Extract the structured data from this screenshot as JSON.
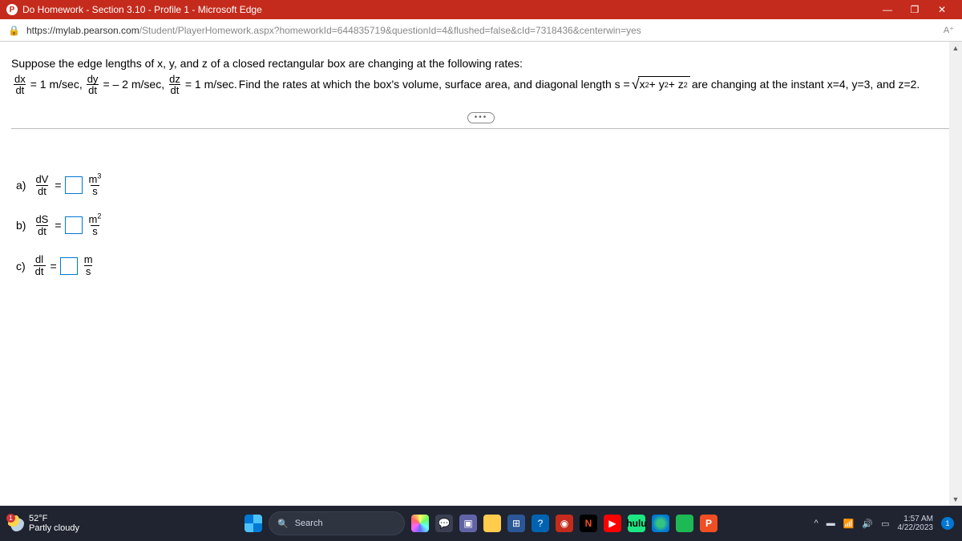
{
  "window": {
    "app_badge": "P",
    "title": "Do Homework - Section 3.10 - Profile 1 - Microsoft Edge",
    "btn_min": "—",
    "btn_max": "❐",
    "btn_close": "✕"
  },
  "address": {
    "lock_icon": "🔒",
    "host": "https://mylab.pearson.com",
    "path": "/Student/PlayerHomework.aspx?homeworkId=644835719&questionId=4&flushed=false&cId=7318436&centerwin=yes",
    "reader": "A⁺"
  },
  "problem": {
    "intro": "Suppose the edge lengths of x, y, and z of a closed rectangular box are changing at the following rates:",
    "dx_num": "dx",
    "dx_den": "dt",
    "dx_eq": "= 1 m/sec,",
    "dy_num": "dy",
    "dy_den": "dt",
    "dy_eq": "= – 2 m/sec,",
    "dz_num": "dz",
    "dz_den": "dt",
    "dz_eq": "= 1 m/sec.",
    "mid": " Find the rates at which the box's volume, surface area, and diagonal length s = ",
    "sqrt_sym": "√",
    "rad_x": "x",
    "rad_y": "+ y",
    "rad_z": "+ z",
    "sq": "2",
    "tail": " are changing at the instant x=4, y=3, and z=2.",
    "ellipsis": "•••"
  },
  "answers": {
    "a": {
      "label": "a)",
      "num": "dV",
      "den": "dt",
      "eq": " = ",
      "unit_num": "m",
      "unit_exp": "3",
      "unit_den": "s"
    },
    "b": {
      "label": "b)",
      "num": "dS",
      "den": "dt",
      "eq": " = ",
      "unit_num": "m",
      "unit_exp": "2",
      "unit_den": "s"
    },
    "c": {
      "label": "c)",
      "num": "dl",
      "den": "dt",
      "eq": " = ",
      "unit_num": "m",
      "unit_exp": "",
      "unit_den": "s"
    }
  },
  "taskbar": {
    "weather_badge": "1",
    "temp": "52°F",
    "condition": "Partly cloudy",
    "search_placeholder": "Search",
    "hulu": "hulu",
    "n": "N",
    "p": "P",
    "chevron": "^",
    "cloud": "▬",
    "wifi": "⚙",
    "vol": "🔊",
    "bat": "▭",
    "time": "1:57 AM",
    "date": "4/22/2023",
    "notif": "1"
  }
}
